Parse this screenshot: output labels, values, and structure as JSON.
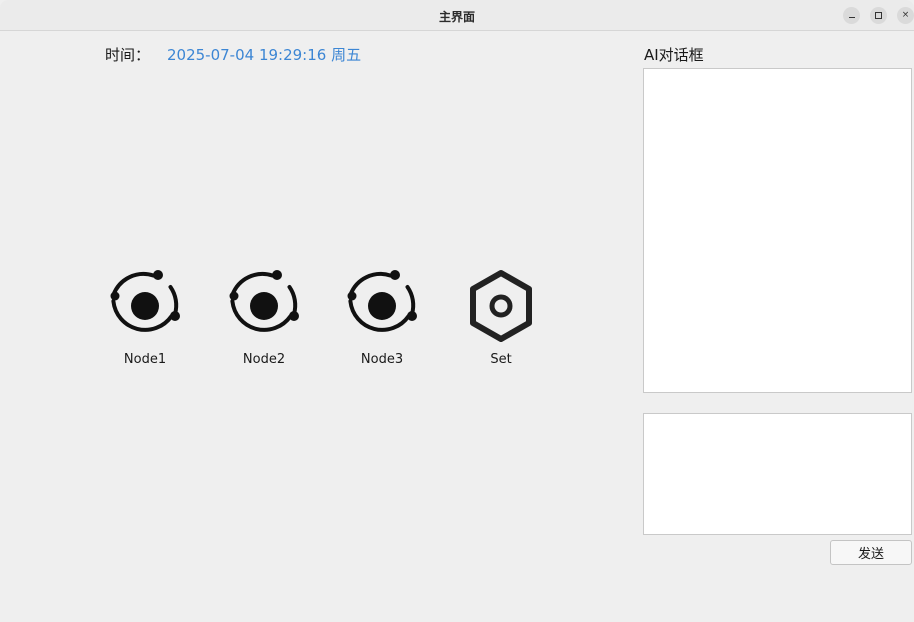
{
  "window": {
    "title": "主界面",
    "minimize_icon": "minimize-icon",
    "maximize_icon": "maximize-icon",
    "close_icon": "close-icon",
    "close_glyph": "×"
  },
  "time": {
    "label": "时间：",
    "value": "2025-07-04 19:29:16 周五",
    "value_color": "#3c86d4"
  },
  "nodes": [
    {
      "label": "Node1",
      "icon": "orbit-icon"
    },
    {
      "label": "Node2",
      "icon": "orbit-icon"
    },
    {
      "label": "Node3",
      "icon": "orbit-icon"
    },
    {
      "label": "Set",
      "icon": "hexagon-settings-icon"
    }
  ],
  "chat": {
    "label": "AI对话框",
    "input_value": "",
    "send_label": "发送"
  }
}
